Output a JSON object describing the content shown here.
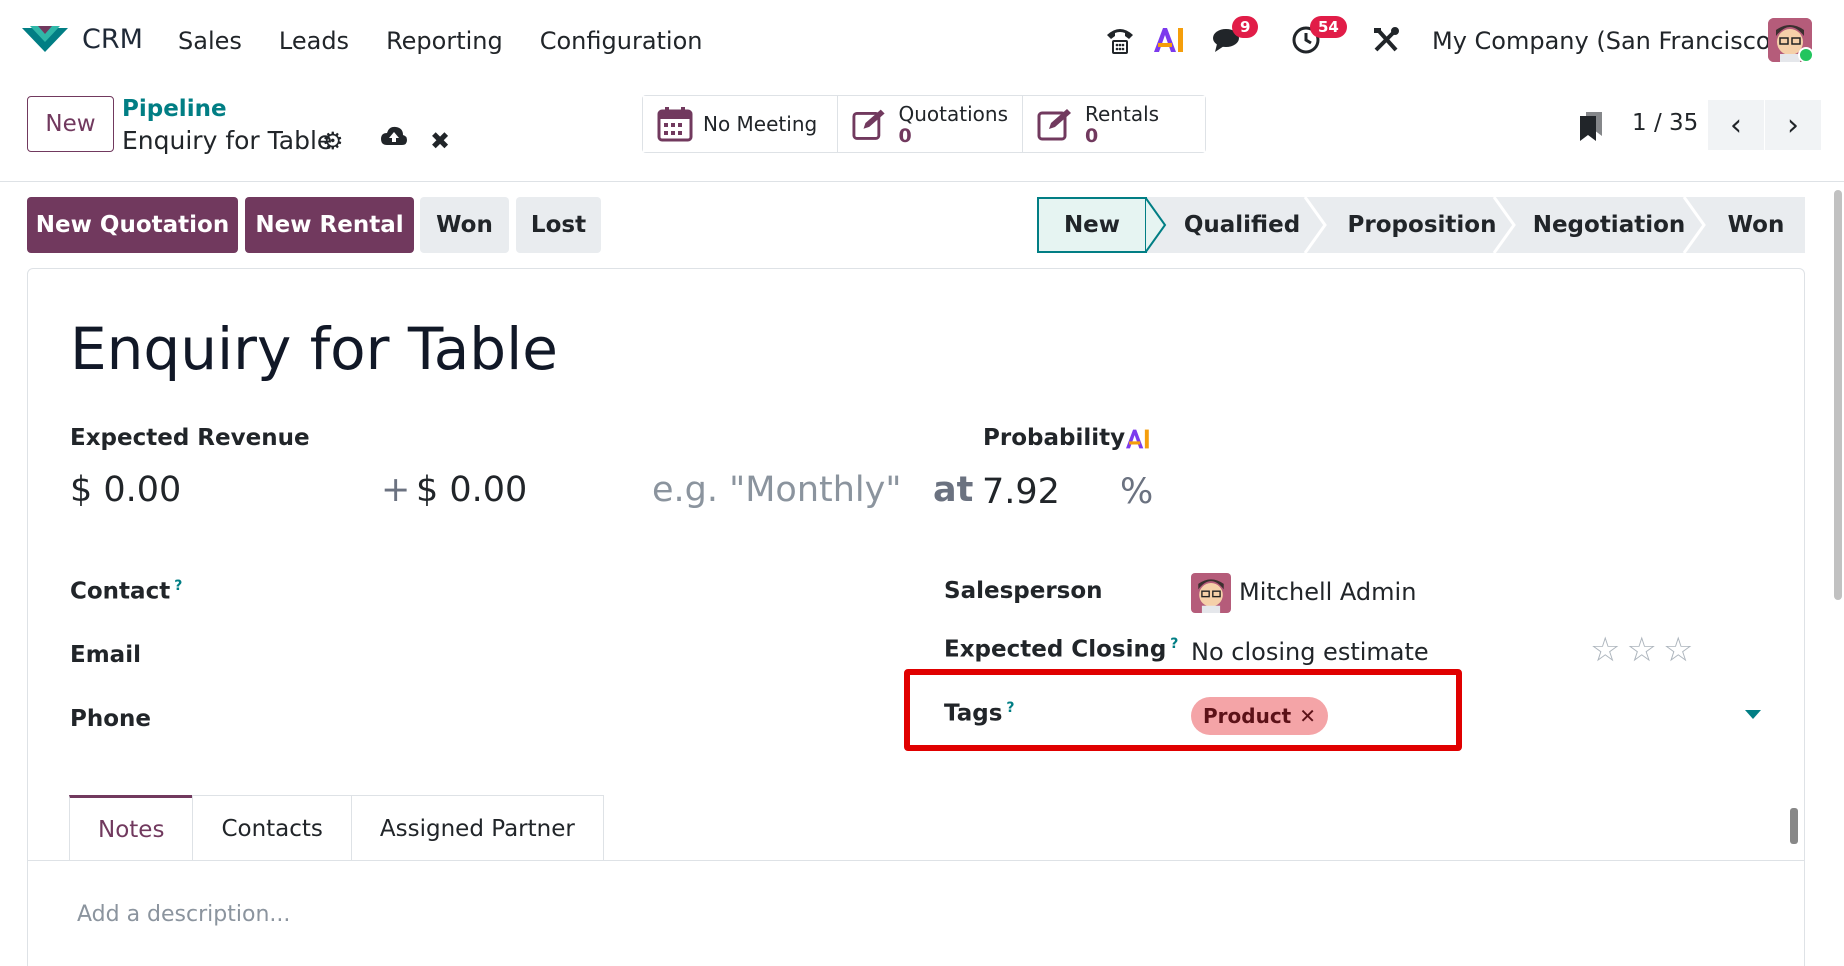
{
  "navbar": {
    "app_name": "CRM",
    "menu": [
      "Sales",
      "Leads",
      "Reporting",
      "Configuration"
    ],
    "messages_badge": "9",
    "activities_badge": "54",
    "company": "My Company (San Francisco)"
  },
  "control": {
    "new_label": "New",
    "breadcrumb": "Pipeline",
    "record_name": "Enquiry for Table",
    "smart_buttons": [
      {
        "label": "No Meeting",
        "count": ""
      },
      {
        "label": "Quotations",
        "count": "0"
      },
      {
        "label": "Rentals",
        "count": "0"
      }
    ],
    "pager": "1 / 35"
  },
  "actions": {
    "new_quotation": "New Quotation",
    "new_rental": "New Rental",
    "won": "Won",
    "lost": "Lost"
  },
  "stages": [
    "New",
    "Qualified",
    "Proposition",
    "Negotiation",
    "Won"
  ],
  "active_stage": "New",
  "form": {
    "title": "Enquiry for Table",
    "expected_revenue_label": "Expected Revenue",
    "expected_revenue": "$ 0.00",
    "plus_sign": "+",
    "recurring_revenue": "$ 0.00",
    "recurring_placeholder": "e.g. \"Monthly\"",
    "at_label": "at",
    "probability_label": "Probability",
    "probability": "7.92",
    "percent": "%",
    "contact_label": "Contact",
    "email_label": "Email",
    "phone_label": "Phone",
    "salesperson_label": "Salesperson",
    "salesperson": "Mitchell Admin",
    "expected_closing_label": "Expected Closing",
    "expected_closing_placeholder": "No closing estimate",
    "tags_label": "Tags",
    "tags": [
      "Product"
    ],
    "help_mark": "?"
  },
  "tabs": [
    "Notes",
    "Contacts",
    "Assigned Partner"
  ],
  "notes_placeholder": "Add a description...",
  "colors": {
    "brand": "#71395e",
    "teal": "#017e84",
    "tag_bg": "#f4a4a7",
    "highlight": "#e00000",
    "badge": "#e11d48"
  }
}
